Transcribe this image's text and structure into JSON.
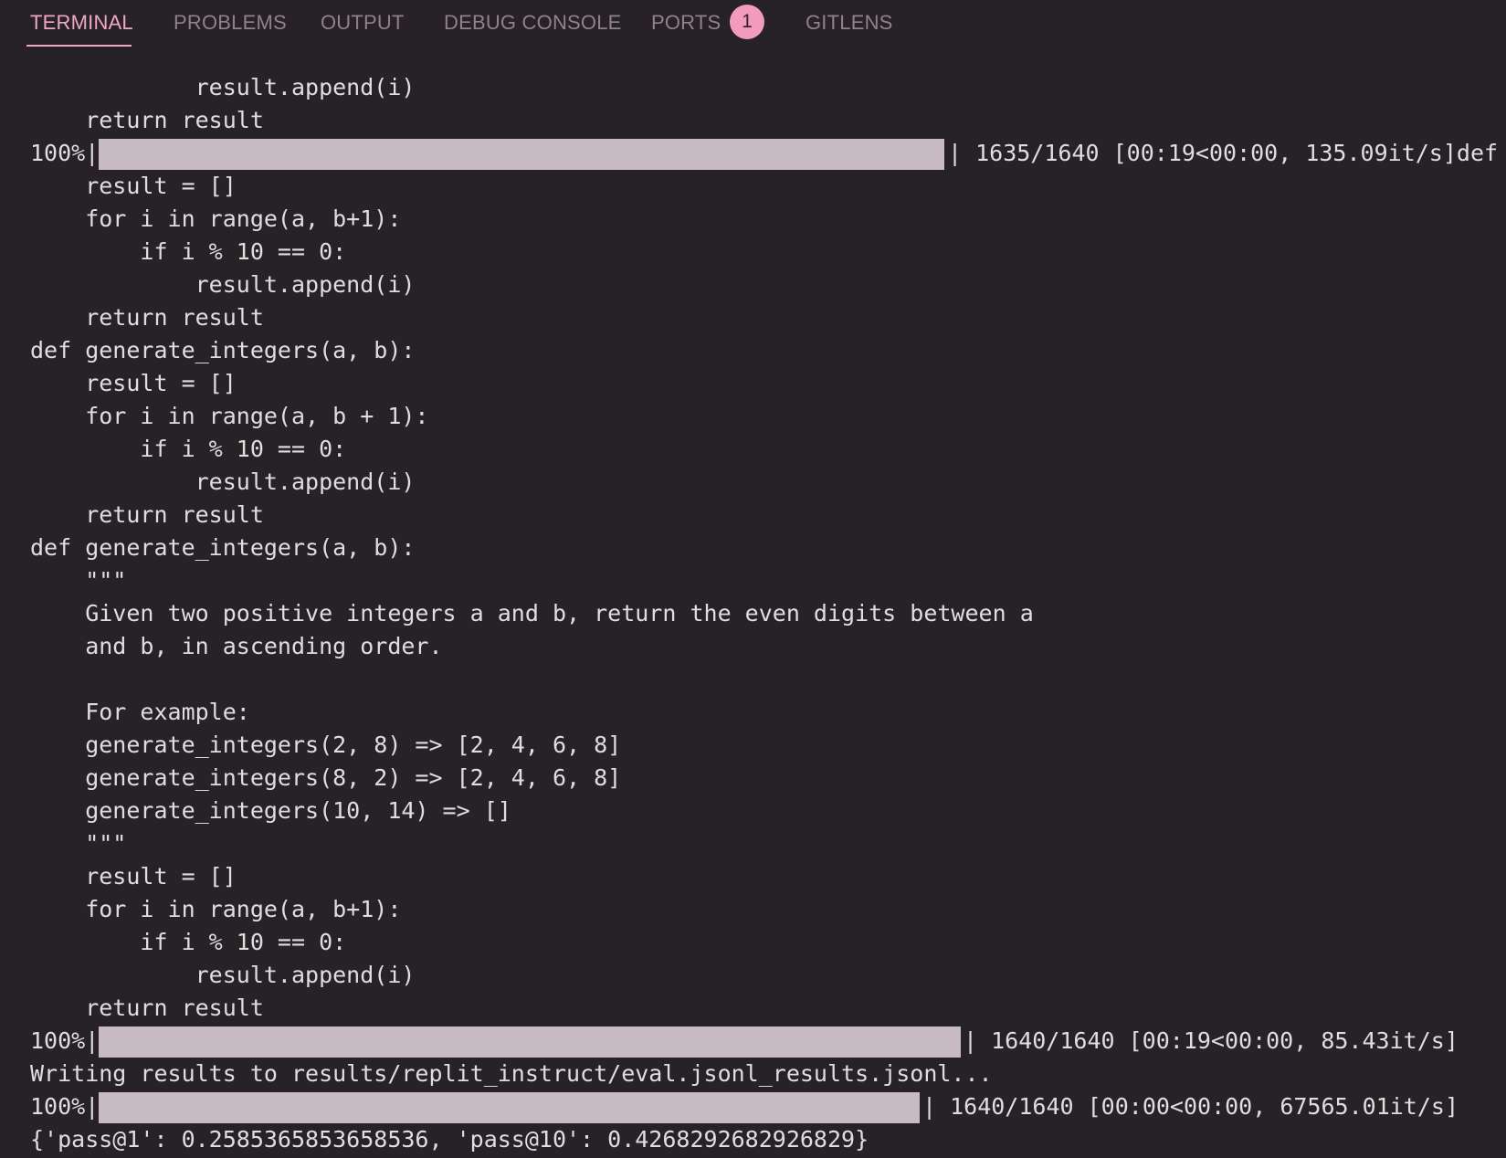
{
  "panel": {
    "tabs": [
      {
        "label": "TERMINAL",
        "active": true
      },
      {
        "label": "PROBLEMS",
        "active": false
      },
      {
        "label": "OUTPUT",
        "active": false
      },
      {
        "label": "DEBUG CONSOLE",
        "active": false
      },
      {
        "label": "PORTS",
        "active": false
      },
      {
        "label": "GITLENS",
        "active": false
      }
    ],
    "ports_badge": "1"
  },
  "colors": {
    "background": "#272225",
    "text": "#e2dbe0",
    "active_tab": "#f0a6c6",
    "inactive_tab": "#8f8289",
    "badge_bg": "#f29bbd",
    "badge_text": "#3a1f2c",
    "progress_fill": "#c8bcc2"
  },
  "terminal": {
    "lines": [
      "            result.append(i)",
      "    return result",
      "    result = []",
      "    for i in range(a, b+1):",
      "        if i % 10 == 0:",
      "            result.append(i)",
      "    return result",
      "def generate_integers(a, b):",
      "    result = []",
      "    for i in range(a, b + 1):",
      "        if i % 10 == 0:",
      "            result.append(i)",
      "    return result",
      "def generate_integers(a, b):",
      "    \"\"\"",
      "    Given two positive integers a and b, return the even digits between a",
      "    and b, in ascending order.",
      "",
      "    For example:",
      "    generate_integers(2, 8) => [2, 4, 6, 8]",
      "    generate_integers(8, 2) => [2, 4, 6, 8]",
      "    generate_integers(10, 14) => []",
      "    \"\"\"",
      "    result = []",
      "    for i in range(a, b+1):",
      "        if i % 10 == 0:",
      "            result.append(i)",
      "    return result",
      "Writing results to results/replit_instruct/eval.jsonl_results.jsonl...",
      "{'pass@1': 0.2585365853658536, 'pass@10': 0.4268292682926829}"
    ],
    "progress": [
      {
        "percent_label": "100%|",
        "fraction": 1.0,
        "stats": "| 1635/1640 [00:19<00:00, 135.09it/s]def"
      },
      {
        "percent_label": "100%|",
        "fraction": 1.0,
        "stats": "| 1640/1640 [00:19<00:00, 85.43it/s]"
      },
      {
        "percent_label": "100%|",
        "fraction": 1.0,
        "stats": "| 1640/1640 [00:00<00:00, 67565.01it/s]"
      }
    ]
  }
}
